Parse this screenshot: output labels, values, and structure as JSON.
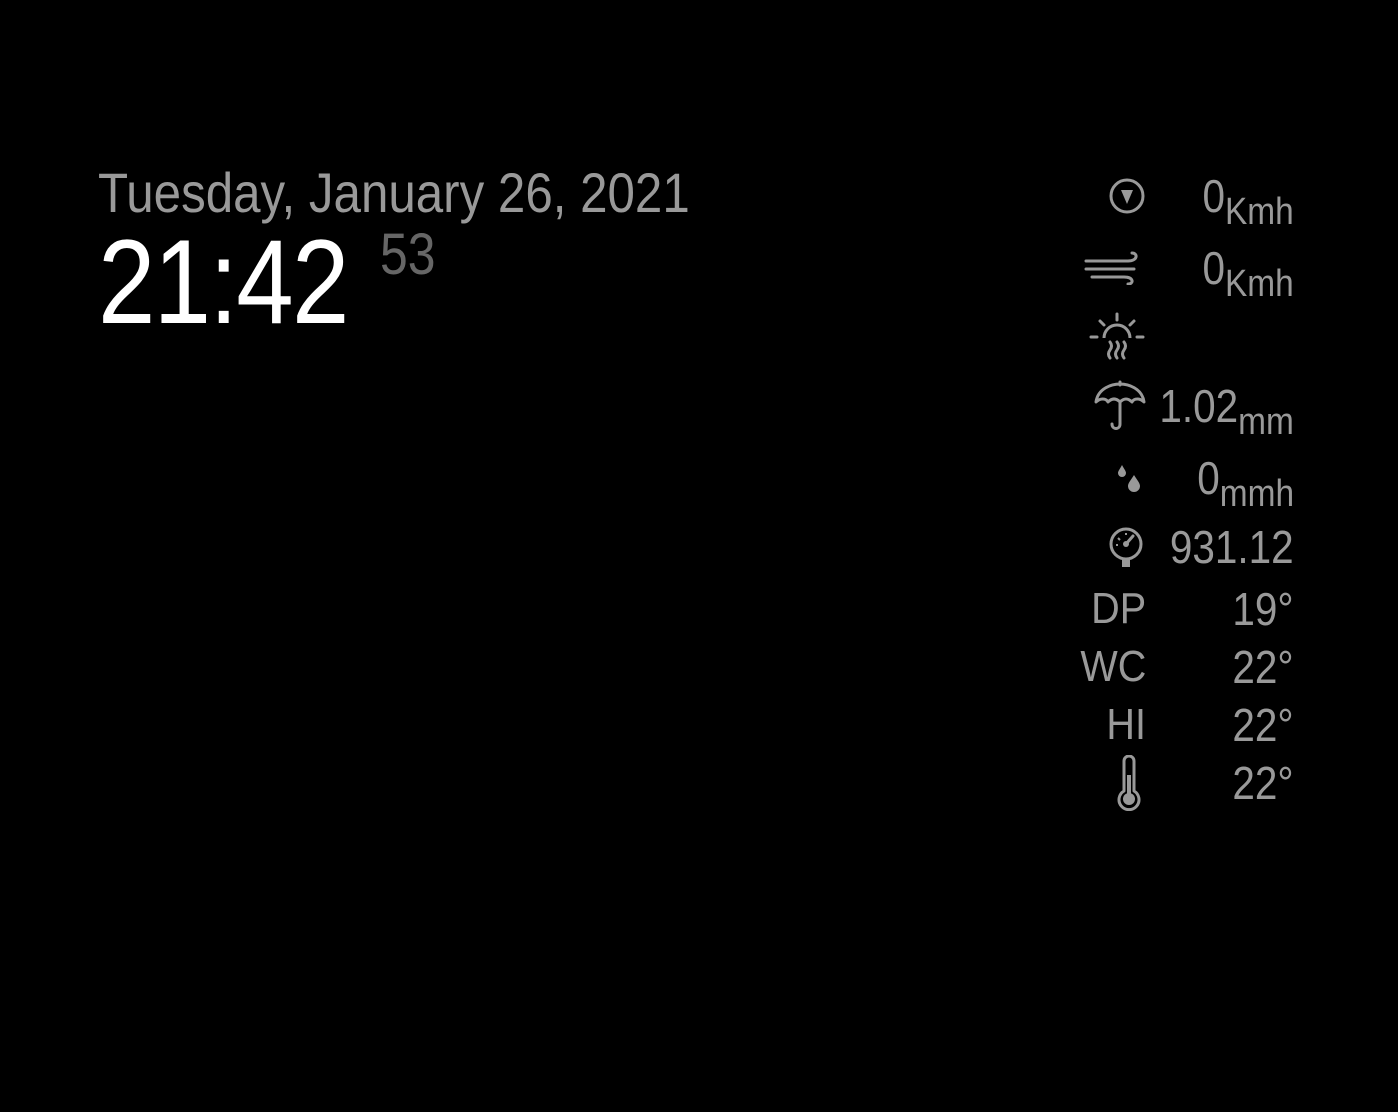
{
  "clock": {
    "date": "Tuesday, January 26, 2021",
    "hours_minutes": "21:42",
    "seconds": "53"
  },
  "weather": {
    "rows": [
      {
        "icon": "wind-direction-icon",
        "value": "0",
        "unit": "Kmh"
      },
      {
        "icon": "wind-speed-icon",
        "value": "0",
        "unit": "Kmh"
      },
      {
        "icon": "uv-sun-haze-icon",
        "value": "",
        "unit": ""
      },
      {
        "icon": "umbrella-icon",
        "value": "1.02",
        "unit": "mm"
      },
      {
        "icon": "raindrops-icon",
        "value": "0",
        "unit": "mmh"
      },
      {
        "icon": "barometer-icon",
        "value": "931.12",
        "unit": ""
      },
      {
        "label": "DP",
        "value": "19°"
      },
      {
        "label": "WC",
        "value": "22°"
      },
      {
        "label": "HI",
        "value": "22°"
      },
      {
        "icon": "thermometer-icon",
        "value": "22°"
      }
    ]
  },
  "colors": {
    "background": "#000000",
    "primary_text": "#ffffff",
    "secondary_text": "#999999",
    "dim_text": "#666666"
  }
}
